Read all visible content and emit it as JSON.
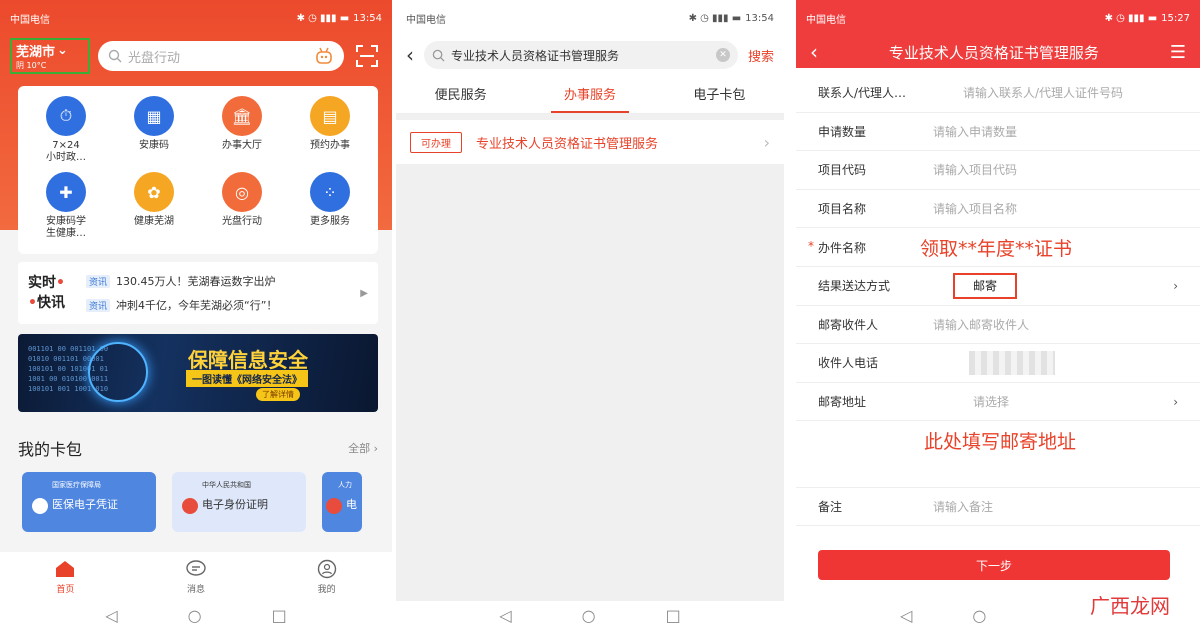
{
  "phone1": {
    "status": {
      "carrier": "中国电信",
      "time": "13:54"
    },
    "city": "芜湖市",
    "weather": "阴 10°C",
    "search_placeholder": "光盘行动",
    "services": [
      {
        "label": "7×24\n小时政…",
        "icon": "clock-doc-icon",
        "color": "#2f6fe0"
      },
      {
        "label": "安康码",
        "icon": "qr-code-icon",
        "color": "#2f6fe0"
      },
      {
        "label": "办事大厅",
        "icon": "building-icon",
        "color": "#f26b3a"
      },
      {
        "label": "预约办事",
        "icon": "calendar-icon",
        "color": "#f5a623"
      },
      {
        "label": "安康码学\n生健康…",
        "icon": "student-health-icon",
        "color": "#2f6fe0"
      },
      {
        "label": "健康芜湖",
        "icon": "health-icon",
        "color": "#f5a623"
      },
      {
        "label": "光盘行动",
        "icon": "plate-icon",
        "color": "#f26b3a"
      },
      {
        "label": "更多服务",
        "icon": "grid-icon",
        "color": "#2f6fe0"
      }
    ],
    "news": {
      "brand_line1": "实时",
      "brand_line2": "快讯",
      "items": [
        {
          "tag": "资讯",
          "text": "130.45万人！芜湖春运数字出炉"
        },
        {
          "tag": "资讯",
          "text": "冲刺4千亿，今年芜湖必须“行”！"
        }
      ]
    },
    "banner": {
      "title": "保障信息安全",
      "subtitle": "一图读懂《网络安全法》",
      "button": "了解详情"
    },
    "wallet": {
      "title": "我的卡包",
      "all": "全部",
      "cards": [
        {
          "small": "国家医疗保障局",
          "name": "医保电子凭证",
          "bg": "#4f86e0",
          "fg": "#ffffff"
        },
        {
          "small": "中华人民共和国",
          "name": "电子身份证明",
          "bg": "#dfe8fb",
          "fg": "#333333"
        },
        {
          "small": "人力",
          "name": "电",
          "bg": "#4f86e0",
          "fg": "#ffffff"
        }
      ]
    },
    "tabs": [
      {
        "label": "首页",
        "active": true
      },
      {
        "label": "消息",
        "active": false
      },
      {
        "label": "我的",
        "active": false
      }
    ]
  },
  "phone2": {
    "status": {
      "carrier": "中国电信",
      "time": "13:54"
    },
    "search_value": "专业技术人员资格证书管理服务",
    "search_button": "搜索",
    "tabs": [
      {
        "label": "便民服务",
        "active": false
      },
      {
        "label": "办事服务",
        "active": true
      },
      {
        "label": "电子卡包",
        "active": false
      }
    ],
    "result": {
      "badge": "可办理",
      "name": "专业技术人员资格证书管理服务"
    }
  },
  "phone3": {
    "status": {
      "carrier": "中国电信",
      "time": "15:27"
    },
    "title": "专业技术人员资格证书管理服务",
    "fields": [
      {
        "label": "联系人/代理人…",
        "value": "请输入联系人/代理人证件号码"
      },
      {
        "label": "申请数量",
        "value": "请输入申请数量"
      },
      {
        "label": "项目代码",
        "value": "请输入项目代码"
      },
      {
        "label": "项目名称",
        "value": "请输入项目名称"
      },
      {
        "label": "办件名称",
        "value": "",
        "required": true
      },
      {
        "label": "结果送达方式",
        "value": "邮寄"
      },
      {
        "label": "邮寄收件人",
        "value": "请输入邮寄收件人"
      },
      {
        "label": "收件人电话",
        "value": ""
      },
      {
        "label": "邮寄地址",
        "value": "请选择"
      },
      {
        "label": "备注",
        "value": "请输入备注"
      }
    ],
    "annotation_name": "领取**年度**证书",
    "annotation_address": "此处填写邮寄地址",
    "next_button": "下一步",
    "watermark": "广西龙网"
  }
}
